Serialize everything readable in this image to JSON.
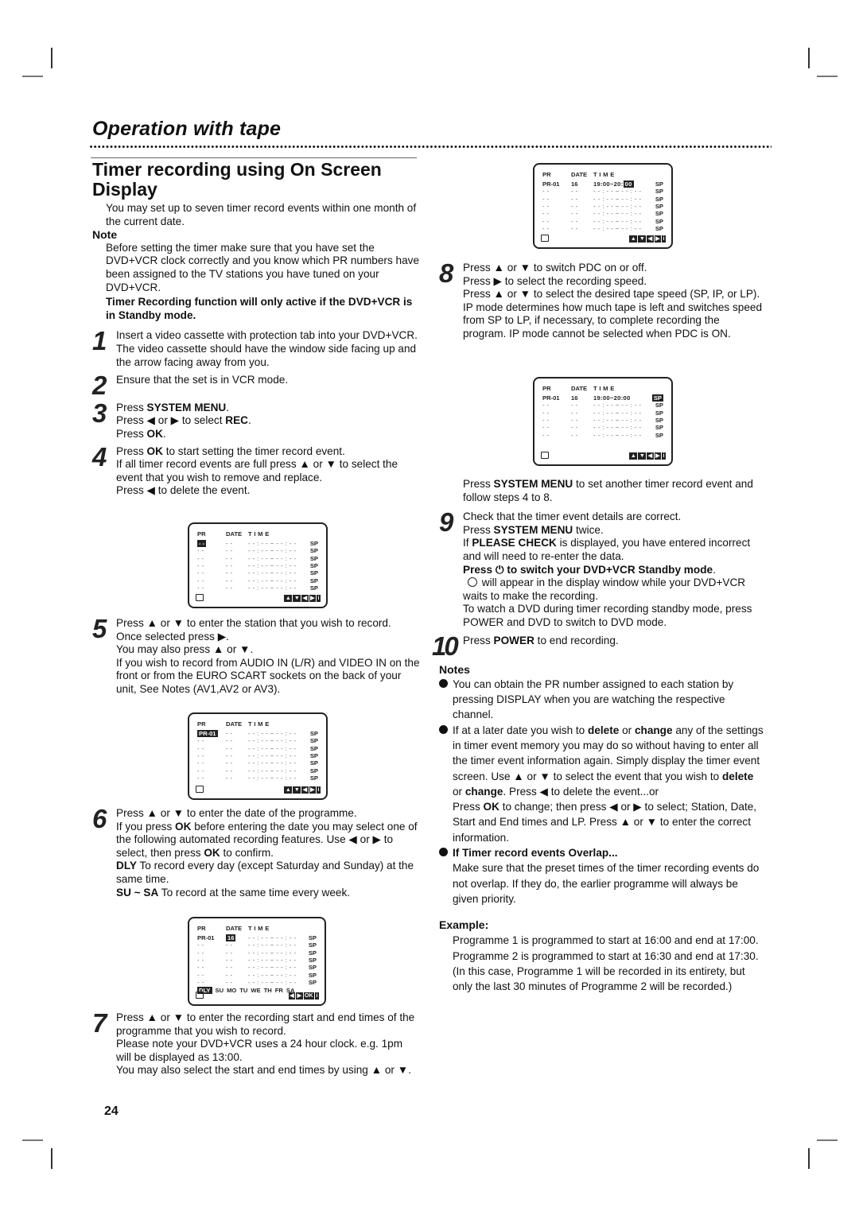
{
  "header": {
    "section_title": "Operation with tape",
    "page_heading": "Timer recording using On Screen Display"
  },
  "intro": "You may set up to seven timer record events within one month of the current date.",
  "note": {
    "heading": "Note",
    "text": "Before setting the timer make sure that you have set the DVD+VCR clock correctly and you know which PR numbers have been assigned to the TV stations you have tuned on your DVD+VCR.",
    "warning": "Timer Recording function will only active if the DVD+VCR is in Standby mode."
  },
  "steps": {
    "s1": {
      "num": "1",
      "l1": "Insert a video cassette with protection tab into your DVD+VCR.",
      "l2": "The video cassette should have the window side facing up and the arrow facing away from you."
    },
    "s2": {
      "num": "2",
      "l1": "Ensure that the set is in VCR mode."
    },
    "s3": {
      "num": "3",
      "press": "Press ",
      "system_menu": "SYSTEM MENU",
      "dot": ".",
      "l2a": "Press ◀ or ▶ to select ",
      "rec": "REC",
      "l3a": "Press ",
      "ok": "OK"
    },
    "s4": {
      "num": "4",
      "l1a": "Press ",
      "ok": "OK",
      "l1b": " to start setting the timer record event.",
      "l2": "If all timer record events are full press ▲ or ▼ to select the event that you wish to remove and replace.",
      "l3": "Press ◀ to delete the event."
    },
    "s5": {
      "num": "5",
      "l1": "Press ▲ or ▼ to enter the station that you wish to record.",
      "l2": "Once selected press ▶.",
      "l3": "You may also press ▲ or ▼.",
      "l4": "If you wish to record from AUDIO IN (L/R) and VIDEO IN on the front or from the EURO SCART sockets on the back of your unit, See Notes (AV1,AV2 or AV3)."
    },
    "s6": {
      "num": "6",
      "l1": "Press ▲ or ▼ to enter the date of the programme.",
      "l2a": "If you press ",
      "ok": "OK",
      "l2b": " before entering the date you may select one of the following automated recording features. Use ◀ or ▶ to select, then press ",
      "l2c": " to confirm.",
      "dly": "DLY",
      "dly_text": " To record every day (except Saturday and Sunday) at the same time.",
      "susa": "SU ~ SA",
      "susa_text": " To record at the same time every week."
    },
    "s7": {
      "num": "7",
      "l1": "Press ▲ or ▼ to enter the recording start and end times of the programme that you wish to record.",
      "l2": "Please note your DVD+VCR uses a 24 hour clock. e.g. 1pm will be displayed as 13:00.",
      "l3": "You may also select the start and end times by using ▲ or ▼."
    },
    "s8": {
      "num": "8",
      "l1": "Press ▲  or ▼ to switch PDC on or off.",
      "l2": "Press ▶  to select the recording speed.",
      "l3": "Press ▲ or ▼  to select the desired tape speed (SP, IP, or LP).",
      "l4": "IP mode determines how much tape is left and switches speed from SP to LP, if necessary, to complete recording the program. IP mode cannot be selected when PDC is ON."
    },
    "after8": {
      "a": "Press ",
      "system_menu": "SYSTEM MENU",
      "b": " to set another timer record event and follow steps 4 to 8."
    },
    "s9": {
      "num": "9",
      "l1": "Check that the timer event details are correct.",
      "l2a": "Press ",
      "system_menu": "SYSTEM MENU",
      "l2b": " twice.",
      "l3a": "If ",
      "please_check": "PLEASE CHECK",
      "l3b": " is displayed, you have entered incorrect and will need to re-enter the data.",
      "l4a": "Press ",
      "l4b": " to switch your DVD+VCR Standby mode",
      "l4c": ".",
      "l5": " will appear in the display window while your DVD+VCR waits to make the recording.",
      "l6": "To watch a DVD during timer recording standby mode, press POWER and DVD to switch to DVD mode."
    },
    "s10": {
      "num": "10",
      "a": "Press ",
      "power": "POWER",
      "b": " to end recording."
    }
  },
  "notes": {
    "heading": "Notes",
    "n1": "You can obtain the PR number assigned to each station by pressing  DISPLAY when you are watching the respective channel.",
    "n2": {
      "a": "If at a later date you wish to ",
      "delete": "delete",
      "or": " or ",
      "change": "change",
      "b": " any of the settings in timer event memory you may do so without having to enter all the timer event information again. Simply display the timer event screen. Use ▲ or ▼ to select the event that you wish to ",
      "c": ". Press ◀ to delete the event...or",
      "d_a": "Press ",
      "ok": "OK",
      "d_b": " to change; then press ◀ or ▶ to select; Station, Date, Start and End times and LP. Press ▲ or ▼ to enter the correct information."
    },
    "n3": {
      "heading": "If Timer record events Overlap...",
      "text": "Make sure that the preset times of the timer recording events do not overlap. If they do, the earlier programme will always be given priority."
    }
  },
  "example": {
    "heading": "Example:",
    "p1": "Programme 1 is programmed to start at 16:00 and end at 17:00.",
    "p2": "Programme 2 is programmed to start at 16:30 and end at 17:30.",
    "p3": "(In this case, Programme 1 will be recorded in its entirety, but only the last 30 minutes of Programme 2 will be recorded.)"
  },
  "osd": {
    "headers": {
      "pr": "PR",
      "date": "DATE",
      "time": "T I M E"
    },
    "empty_pr": "- -",
    "empty_date": "- -",
    "empty_time": "- - : - - ~ - - : - -",
    "speed": "SP",
    "set_pr": "PR-01",
    "set_date": "16",
    "set_time_a": "19:00~20:",
    "set_time_b": "00",
    "set_time_full": "19:00~20:00",
    "nav": [
      "▲",
      "▼",
      "◀",
      "▶",
      "i"
    ],
    "nav_ok": [
      "◀",
      "▶",
      "OK",
      "i"
    ],
    "days": {
      "dly": "DLY",
      "list": [
        "SU",
        "MO",
        "TU",
        "WE",
        "TH",
        "FR",
        "SA"
      ]
    }
  },
  "page_number": "24"
}
